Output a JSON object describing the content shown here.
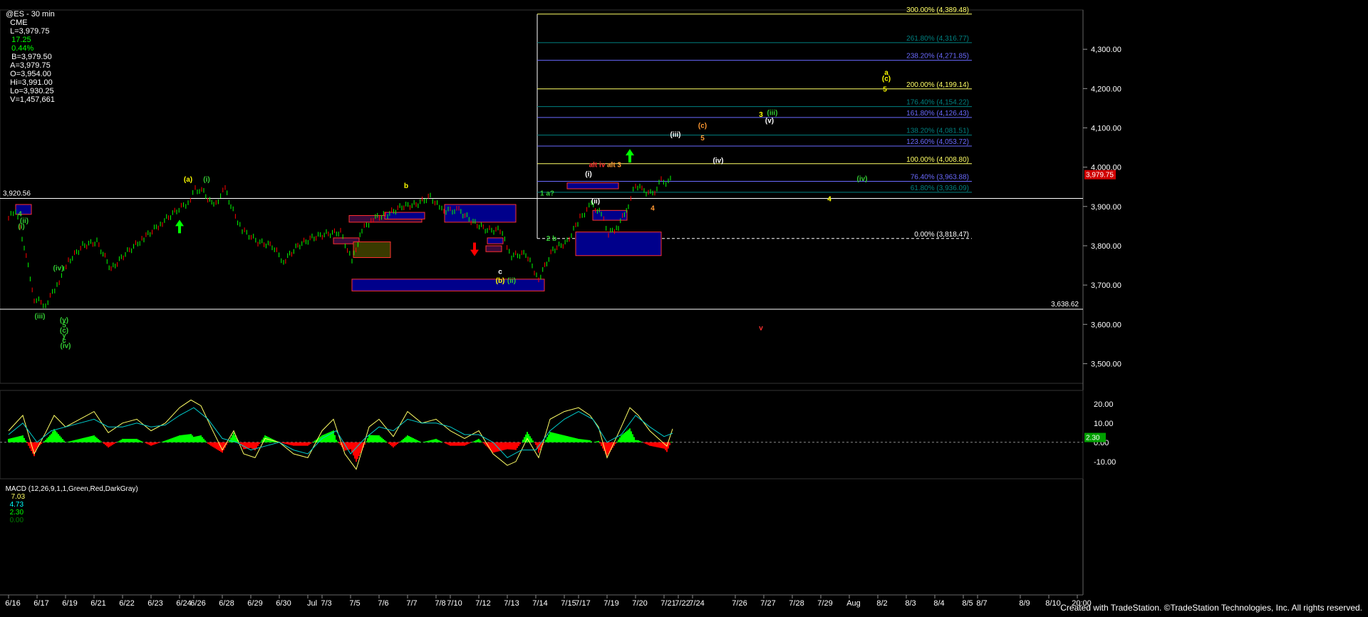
{
  "header": {
    "symbol": "@ES - 30 min",
    "exchange": "CME",
    "last": "L=3,979.75",
    "change": "17.25",
    "change_pct": "0.44%",
    "bid": "B=3,979.50",
    "ask": "A=3,979.75",
    "open": "O=3,954.00",
    "high": "Hi=3,991.00",
    "low": "Lo=3,930.25",
    "volume": "V=1,457,661"
  },
  "macd_header": {
    "label": "MACD (12,26,9,1,1,Green,Red,DarkGray)",
    "v1": "7.03",
    "v2": "4.73",
    "v3": "2.30",
    "v4": "0.00"
  },
  "footer": "Created with TradeStation. ©TradeStation Technologies, Inc. All rights reserved.",
  "colors": {
    "up": "#00ff00",
    "down": "#ff0000",
    "fib_blue": "#6a6aff",
    "fib_yellow": "#ffff66",
    "box_blue": "#00008b",
    "box_border": "#ff3030",
    "label_green": "#33cc33",
    "label_yellow": "#ffff00",
    "label_orange": "#ff9933",
    "label_white": "#ffffff"
  },
  "chart_data": {
    "type": "line",
    "title": "",
    "xlabel": "",
    "ylabel": "",
    "ylim": [
      3450,
      4400
    ],
    "macd_ylim": [
      -16,
      24
    ],
    "last_price": "3,979.75",
    "price_ticks": [
      "4,300.00",
      "4,200.00",
      "4,100.00",
      "4,000.00",
      "3,900.00",
      "3,800.00",
      "3,700.00",
      "3,600.00",
      "3,500.00"
    ],
    "price_tick_values": [
      4300,
      4200,
      4100,
      4000,
      3900,
      3800,
      3700,
      3600,
      3500
    ],
    "macd_ticks": [
      "20.00",
      "10.00",
      "0.00",
      "-10.00"
    ],
    "macd_tick_values": [
      20,
      10,
      0,
      -10
    ],
    "macd_value_label": "2.30",
    "x_labels": [
      "6/16",
      "6/17",
      "6/19",
      "6/21",
      "6/22",
      "6/23",
      "6/24",
      "6/26",
      "6/28",
      "6/29",
      "6/30",
      "Jul",
      "7/3",
      "7/5",
      "7/6",
      "7/7",
      "7/8",
      "7/10",
      "7/12",
      "7/13",
      "7/14",
      "7/15",
      "7/17",
      "7/19",
      "7/20",
      "7/21",
      "7/22",
      "7/24",
      "7/26",
      "7/27",
      "7/28",
      "7/29",
      "Aug",
      "8/2",
      "8/3",
      "8/4",
      "8/5",
      "8/7",
      "8/9",
      "8/10",
      "20:00"
    ],
    "x_index": [
      0,
      2,
      4,
      6,
      8,
      10,
      12,
      13,
      15,
      17,
      19,
      21,
      22,
      24,
      26,
      28,
      30,
      31,
      33,
      35,
      37,
      39,
      40,
      42,
      44,
      46,
      47,
      48,
      51,
      53,
      55,
      57,
      59,
      61,
      63,
      65,
      67,
      68,
      71,
      73,
      75
    ],
    "price_path": [
      [
        0,
        3870
      ],
      [
        0.5,
        3890
      ],
      [
        1.1,
        3800
      ],
      [
        1.8,
        3665
      ],
      [
        2.6,
        3650
      ],
      [
        3.4,
        3700
      ],
      [
        4.2,
        3760
      ],
      [
        5.2,
        3800
      ],
      [
        6.2,
        3810
      ],
      [
        7.2,
        3740
      ],
      [
        8.2,
        3780
      ],
      [
        9.5,
        3820
      ],
      [
        10.8,
        3860
      ],
      [
        11.8,
        3890
      ],
      [
        12.6,
        3910
      ],
      [
        13.1,
        3945
      ],
      [
        13.7,
        3935
      ],
      [
        14.4,
        3900
      ],
      [
        15.2,
        3945
      ],
      [
        15.6,
        3900
      ],
      [
        16.4,
        3840
      ],
      [
        17.5,
        3810
      ],
      [
        18.5,
        3800
      ],
      [
        19.3,
        3760
      ],
      [
        20.3,
        3800
      ],
      [
        21.3,
        3820
      ],
      [
        22.3,
        3830
      ],
      [
        23.3,
        3835
      ],
      [
        24.1,
        3760
      ],
      [
        24.8,
        3840
      ],
      [
        25.6,
        3870
      ],
      [
        26.6,
        3880
      ],
      [
        27.6,
        3900
      ],
      [
        28.6,
        3905
      ],
      [
        29.6,
        3925
      ],
      [
        30.4,
        3890
      ],
      [
        31.6,
        3890
      ],
      [
        32.6,
        3860
      ],
      [
        33.6,
        3840
      ],
      [
        34.5,
        3840
      ],
      [
        35.3,
        3775
      ],
      [
        36.3,
        3780
      ],
      [
        37.2,
        3715
      ],
      [
        38.2,
        3790
      ],
      [
        39.2,
        3810
      ],
      [
        40.1,
        3870
      ],
      [
        40.9,
        3905
      ],
      [
        41.6,
        3880
      ],
      [
        42.1,
        3830
      ],
      [
        42.8,
        3850
      ],
      [
        43.5,
        3905
      ],
      [
        44.0,
        3955
      ],
      [
        44.6,
        3940
      ],
      [
        45.2,
        3930
      ],
      [
        45.8,
        3965
      ],
      [
        46.3,
        3960
      ],
      [
        46.6,
        3980
      ]
    ],
    "macd_path": [
      [
        0,
        6
      ],
      [
        1,
        14
      ],
      [
        1.8,
        -6
      ],
      [
        2.6,
        5
      ],
      [
        3.2,
        14
      ],
      [
        4,
        8
      ],
      [
        5,
        12
      ],
      [
        6,
        16
      ],
      [
        7,
        5
      ],
      [
        8,
        10
      ],
      [
        9,
        12
      ],
      [
        10,
        6
      ],
      [
        11,
        10
      ],
      [
        12,
        18
      ],
      [
        12.8,
        22
      ],
      [
        13.5,
        19
      ],
      [
        14.2,
        8
      ],
      [
        15,
        -4
      ],
      [
        15.8,
        6
      ],
      [
        16.5,
        -6
      ],
      [
        17.3,
        -8
      ],
      [
        18,
        2
      ],
      [
        19,
        0
      ],
      [
        20,
        -6
      ],
      [
        21,
        -8
      ],
      [
        22,
        6
      ],
      [
        22.8,
        12
      ],
      [
        23.6,
        -6
      ],
      [
        24.4,
        -14
      ],
      [
        25.3,
        8
      ],
      [
        26,
        12
      ],
      [
        27,
        3
      ],
      [
        28,
        16
      ],
      [
        29,
        10
      ],
      [
        30,
        12
      ],
      [
        31,
        6
      ],
      [
        32,
        2
      ],
      [
        33,
        6
      ],
      [
        34,
        -6
      ],
      [
        35,
        -12
      ],
      [
        35.6,
        -10
      ],
      [
        36.4,
        2
      ],
      [
        37.2,
        -8
      ],
      [
        38,
        12
      ],
      [
        39,
        16
      ],
      [
        40,
        18
      ],
      [
        40.8,
        14
      ],
      [
        41.4,
        8
      ],
      [
        42,
        -8
      ],
      [
        43,
        8
      ],
      [
        43.6,
        18
      ],
      [
        44.2,
        14
      ],
      [
        45,
        6
      ],
      [
        45.6,
        2
      ],
      [
        46.2,
        -2
      ],
      [
        46.6,
        7
      ]
    ],
    "macd_signal_path": [
      [
        0,
        4
      ],
      [
        1,
        10
      ],
      [
        2,
        0
      ],
      [
        3,
        6
      ],
      [
        4,
        8
      ],
      [
        5,
        10
      ],
      [
        6,
        12
      ],
      [
        7,
        8
      ],
      [
        8,
        8
      ],
      [
        9,
        10
      ],
      [
        10,
        8
      ],
      [
        11,
        9
      ],
      [
        12,
        14
      ],
      [
        13,
        18
      ],
      [
        14,
        12
      ],
      [
        15,
        2
      ],
      [
        16,
        0
      ],
      [
        17,
        -4
      ],
      [
        18,
        -2
      ],
      [
        19,
        0
      ],
      [
        20,
        -4
      ],
      [
        21,
        -6
      ],
      [
        22,
        2
      ],
      [
        23,
        6
      ],
      [
        24,
        -6
      ],
      [
        25,
        2
      ],
      [
        26,
        8
      ],
      [
        27,
        6
      ],
      [
        28,
        12
      ],
      [
        29,
        10
      ],
      [
        30,
        10
      ],
      [
        31,
        8
      ],
      [
        32,
        4
      ],
      [
        33,
        4
      ],
      [
        34,
        0
      ],
      [
        35,
        -8
      ],
      [
        36,
        -4
      ],
      [
        37,
        -4
      ],
      [
        38,
        6
      ],
      [
        39,
        12
      ],
      [
        40,
        16
      ],
      [
        41,
        12
      ],
      [
        42,
        0
      ],
      [
        43,
        4
      ],
      [
        44,
        14
      ],
      [
        45,
        8
      ],
      [
        46,
        3
      ],
      [
        46.6,
        4.7
      ]
    ],
    "hlines": [
      {
        "value": 3920.56,
        "label": "3,920.56",
        "side": "left"
      },
      {
        "value": 3638.62,
        "label": "3,638.62",
        "side": "right"
      }
    ],
    "fib_levels": [
      {
        "value": 4389.48,
        "label": "300.00% (4,389.48)",
        "color": "#ffff66"
      },
      {
        "value": 4316.77,
        "label": "261.80% (4,316.77)",
        "color": "#008080"
      },
      {
        "value": 4271.85,
        "label": "238.20% (4,271.85)",
        "color": "#6a6aff"
      },
      {
        "value": 4199.14,
        "label": "200.00% (4,199.14)",
        "color": "#ffff66"
      },
      {
        "value": 4154.22,
        "label": "176.40% (4,154.22)",
        "color": "#008080"
      },
      {
        "value": 4126.43,
        "label": "161.80% (4,126.43)",
        "color": "#6a6aff"
      },
      {
        "value": 4081.51,
        "label": "138.20% (4,081.51)",
        "color": "#008080"
      },
      {
        "value": 4053.72,
        "label": "123.60% (4,053.72)",
        "color": "#6a6aff"
      },
      {
        "value": 4008.8,
        "label": "100.00% (4,008.80)",
        "color": "#ffff66"
      },
      {
        "value": 3963.88,
        "label": "76.40% (3,963.88)",
        "color": "#6a6aff"
      },
      {
        "value": 3936.09,
        "label": "61.80% (3,936.09)",
        "color": "#008080"
      },
      {
        "value": 3818.47,
        "label": "0.00% (3,818.47)",
        "color": "#ffffff"
      }
    ],
    "boxes": [
      {
        "x0": 0.5,
        "x1": 1.6,
        "y0": 3880,
        "y1": 3905,
        "fill": "#00008b",
        "border": "#ff3030"
      },
      {
        "x0": 22.8,
        "x1": 24.6,
        "y0": 3805,
        "y1": 3820,
        "fill": "#3a0a3a",
        "border": "#ff3030"
      },
      {
        "x0": 24.2,
        "x1": 26.8,
        "y0": 3770,
        "y1": 3810,
        "fill": "#3a3a00",
        "border": "#ff3030"
      },
      {
        "x0": 23.9,
        "x1": 29.0,
        "y0": 3860,
        "y1": 3877,
        "fill": "#3a0a3a",
        "border": "#ff3030"
      },
      {
        "x0": 26.4,
        "x1": 29.2,
        "y0": 3868,
        "y1": 3885,
        "fill": "#00008b",
        "border": "#ff3030"
      },
      {
        "x0": 30.6,
        "x1": 35.6,
        "y0": 3860,
        "y1": 3905,
        "fill": "#00008b",
        "border": "#ff3030"
      },
      {
        "x0": 24.1,
        "x1": 37.6,
        "y0": 3685,
        "y1": 3715,
        "fill": "#00008b",
        "border": "#ff3030"
      },
      {
        "x0": 33.5,
        "x1": 34.6,
        "y0": 3785,
        "y1": 3800,
        "fill": "#3a0a3a",
        "border": "#ff3030"
      },
      {
        "x0": 33.6,
        "x1": 34.7,
        "y0": 3805,
        "y1": 3820,
        "fill": "#00008b",
        "border": "#ff3030"
      },
      {
        "x0": 39.2,
        "x1": 42.8,
        "y0": 3945,
        "y1": 3960,
        "fill": "#00008b",
        "border": "#ff3030"
      },
      {
        "x0": 41.0,
        "x1": 43.4,
        "y0": 3865,
        "y1": 3890,
        "fill": "#00008b",
        "border": "#ff3030"
      },
      {
        "x0": 39.8,
        "x1": 45.8,
        "y0": 3775,
        "y1": 3835,
        "fill": "#00008b",
        "border": "#ff3030"
      }
    ],
    "fib_box": {
      "x0": 37.1,
      "x1": 67.6,
      "y_top": 4389.48,
      "y_bottom": 3818.47
    },
    "wave_labels": [
      {
        "x": 0.8,
        "y": 3875,
        "text": "4",
        "color": "#33cc33"
      },
      {
        "x": 1.1,
        "y": 3858,
        "text": "(ii)",
        "color": "#33cc33"
      },
      {
        "x": 0.9,
        "y": 3843,
        "text": "(i)",
        "color": "#33cc33"
      },
      {
        "x": 3.5,
        "y": 3737,
        "text": "(iv)",
        "color": "#33cc33"
      },
      {
        "x": 2.2,
        "y": 3615,
        "text": "(iii)",
        "color": "#33cc33"
      },
      {
        "x": 3.9,
        "y": 3605,
        "text": "(v)",
        "color": "#33cc33"
      },
      {
        "x": 3.9,
        "y": 3592,
        "text": "5",
        "color": "#33cc33"
      },
      {
        "x": 3.9,
        "y": 3579,
        "text": "(c)",
        "color": "#33cc33"
      },
      {
        "x": 3.9,
        "y": 3566,
        "text": "y",
        "color": "#33cc33"
      },
      {
        "x": 3.9,
        "y": 3553,
        "text": "c",
        "color": "#33cc33"
      },
      {
        "x": 4.0,
        "y": 3540,
        "text": "(iv)",
        "color": "#33cc33"
      },
      {
        "x": 12.6,
        "y": 3963,
        "text": "(a)",
        "color": "#ffff00"
      },
      {
        "x": 13.9,
        "y": 3963,
        "text": "(i)",
        "color": "#33cc33"
      },
      {
        "x": 27.9,
        "y": 3947,
        "text": "b",
        "color": "#ffff00"
      },
      {
        "x": 34.5,
        "y": 3728,
        "text": "c",
        "color": "#ffffff"
      },
      {
        "x": 34.5,
        "y": 3706,
        "text": "(b)",
        "color": "#ffff00"
      },
      {
        "x": 35.3,
        "y": 3706,
        "text": "(ii)",
        "color": "#33cc33"
      },
      {
        "x": 37.8,
        "y": 3928,
        "text": "1 a?",
        "color": "#33cc33"
      },
      {
        "x": 38.1,
        "y": 3813,
        "text": "2 b",
        "color": "#33cc33"
      },
      {
        "x": 40.7,
        "y": 3977,
        "text": "(i)",
        "color": "#ffffff"
      },
      {
        "x": 41.3,
        "y": 4000,
        "text": "alt iv",
        "color": "#ff3030"
      },
      {
        "x": 42.5,
        "y": 4000,
        "text": "alt 3",
        "color": "#ff9933"
      },
      {
        "x": 41.2,
        "y": 3908,
        "text": "(ii)",
        "color": "#ffffff"
      },
      {
        "x": 45.2,
        "y": 3890,
        "text": "4",
        "color": "#ff9933"
      },
      {
        "x": 46.8,
        "y": 4077,
        "text": "(iii)",
        "color": "#ffffff"
      },
      {
        "x": 48.7,
        "y": 4100,
        "text": "(c)",
        "color": "#ff9933"
      },
      {
        "x": 48.7,
        "y": 4068,
        "text": "5",
        "color": "#ff9933"
      },
      {
        "x": 49.8,
        "y": 4011,
        "text": "(iv)",
        "color": "#ffffff"
      },
      {
        "x": 52.8,
        "y": 4128,
        "text": "3",
        "color": "#ffff00"
      },
      {
        "x": 53.6,
        "y": 4133,
        "text": "(iii)",
        "color": "#33cc33"
      },
      {
        "x": 53.4,
        "y": 4113,
        "text": "(v)",
        "color": "#ffffff"
      },
      {
        "x": 57.6,
        "y": 3913,
        "text": "4",
        "color": "#ffff00"
      },
      {
        "x": 59.9,
        "y": 3965,
        "text": "(iv)",
        "color": "#33cc33"
      },
      {
        "x": 61.6,
        "y": 4235,
        "text": "a",
        "color": "#ffff00"
      },
      {
        "x": 61.6,
        "y": 4220,
        "text": "(c)",
        "color": "#ffff00"
      },
      {
        "x": 61.5,
        "y": 4192,
        "text": "5",
        "color": "#ffff00"
      },
      {
        "x": 52.8,
        "y": 3585,
        "text": "v",
        "color": "#ff3030"
      }
    ],
    "arrows": [
      {
        "x": 12.0,
        "y": 3850,
        "dir": "up",
        "color": "#00ff00"
      },
      {
        "x": 43.6,
        "y": 4030,
        "dir": "up",
        "color": "#00ff00"
      },
      {
        "x": 32.7,
        "y": 3790,
        "dir": "down",
        "color": "#ff0000"
      }
    ]
  }
}
